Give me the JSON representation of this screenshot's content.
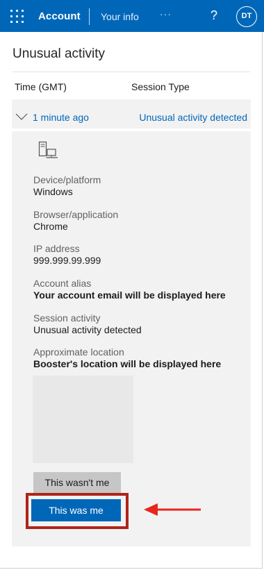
{
  "header": {
    "app_title": "Account",
    "nav_your_info": "Your info",
    "more": "···",
    "help": "?",
    "avatar_initials": "DT",
    "brand_color": "#0067b8"
  },
  "page": {
    "title": "Unusual activity",
    "columns": {
      "time": "Time (GMT)",
      "session_type": "Session Type"
    }
  },
  "activity": {
    "time": "1 minute ago",
    "status": "Unusual activity detected",
    "device_icon": "device-desktop-icon",
    "fields": {
      "device": {
        "label": "Device/platform",
        "value": "Windows"
      },
      "browser": {
        "label": "Browser/application",
        "value": "Chrome"
      },
      "ip": {
        "label": "IP address",
        "value": "999.999.99.999"
      },
      "alias": {
        "label": "Account alias",
        "value": "Your account email will be displayed here"
      },
      "session": {
        "label": "Session activity",
        "value": "Unusual activity detected"
      },
      "location": {
        "label": "Approximate location",
        "value": "Booster's location will be displayed here"
      }
    }
  },
  "actions": {
    "not_me": "This wasn't me",
    "was_me": "This was me",
    "highlight_color": "#b0241a",
    "arrow_color": "#e8261b"
  }
}
